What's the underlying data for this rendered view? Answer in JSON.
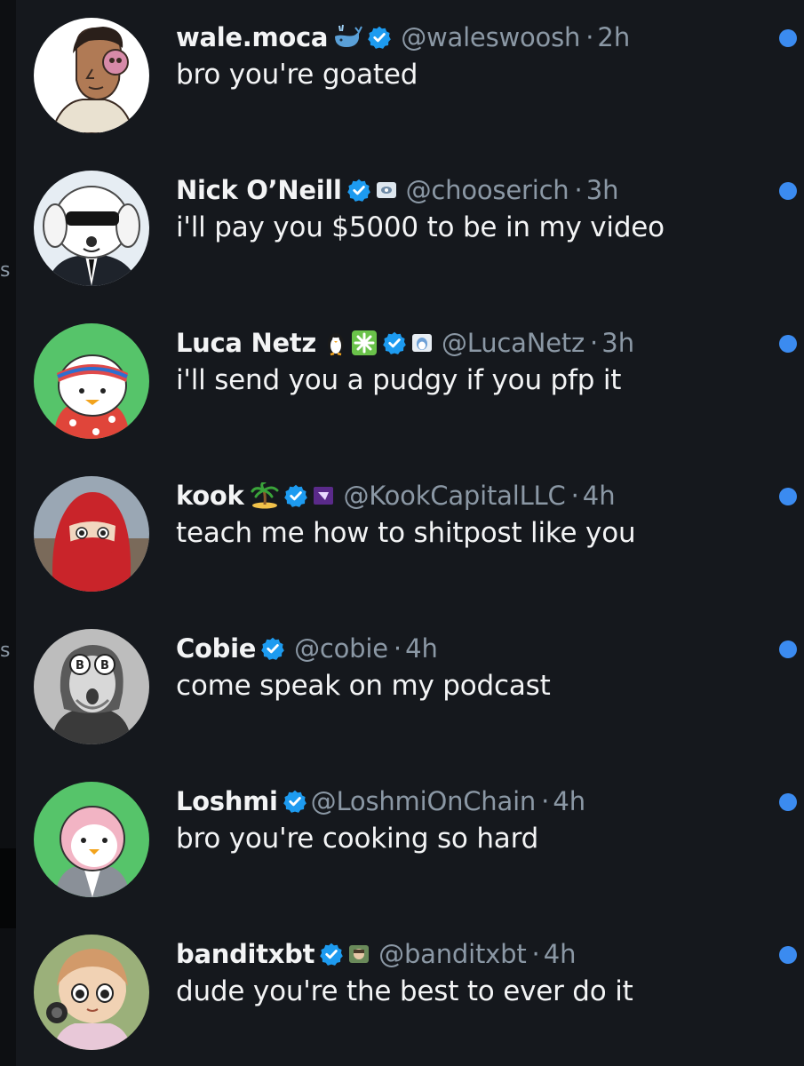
{
  "left_strip": {
    "chars": [
      "s",
      "s"
    ]
  },
  "messages": [
    {
      "name": "wale.moca",
      "handle": "@waleswoosh",
      "separator": "·",
      "time": "2h",
      "text": "bro you're goated",
      "badges": [
        "whale-emoji-icon",
        "verified-badge-icon"
      ],
      "unread": true
    },
    {
      "name": "Nick O’Neill",
      "handle": "@chooserich",
      "separator": "·",
      "time": "3h",
      "text": "i'll pay you $5000 to be in my video",
      "badges": [
        "verified-badge-icon",
        "affiliate-badge-icon"
      ],
      "unread": true
    },
    {
      "name": "Luca Netz",
      "handle": "@LucaNetz",
      "separator": "·",
      "time": "3h",
      "text": "i'll send you a pudgy if you pfp it",
      "badges": [
        "penguin-emoji-icon",
        "sparkle-emoji-icon",
        "verified-badge-icon",
        "affiliate-badge-icon"
      ],
      "unread": true
    },
    {
      "name": "kook",
      "handle": "@KookCapitalLLC",
      "separator": "·",
      "time": "4h",
      "text": "teach me how to shitpost like you",
      "badges": [
        "island-emoji-icon",
        "verified-badge-icon",
        "affiliate-badge-icon"
      ],
      "unread": true
    },
    {
      "name": "Cobie",
      "handle": "@cobie",
      "separator": "·",
      "time": "4h",
      "text": "come speak on my podcast",
      "badges": [
        "verified-badge-icon"
      ],
      "unread": true
    },
    {
      "name": "Loshmi",
      "handle": "@LoshmiOnChain",
      "separator": "·",
      "time": "4h",
      "text": "bro you're cooking so hard",
      "badges": [
        "verified-badge-icon"
      ],
      "unread": true
    },
    {
      "name": "banditxbt",
      "handle": "@banditxbt",
      "separator": "·",
      "time": "4h",
      "text": "dude you're the best to ever do it",
      "badges": [
        "verified-badge-icon",
        "affiliate-badge-icon"
      ],
      "unread": true
    }
  ],
  "colors": {
    "background": "#15181d",
    "text": "#f3f4f5",
    "muted": "#8b98a5",
    "verified": "#1d9bf0",
    "unread": "#3b8bf0"
  }
}
